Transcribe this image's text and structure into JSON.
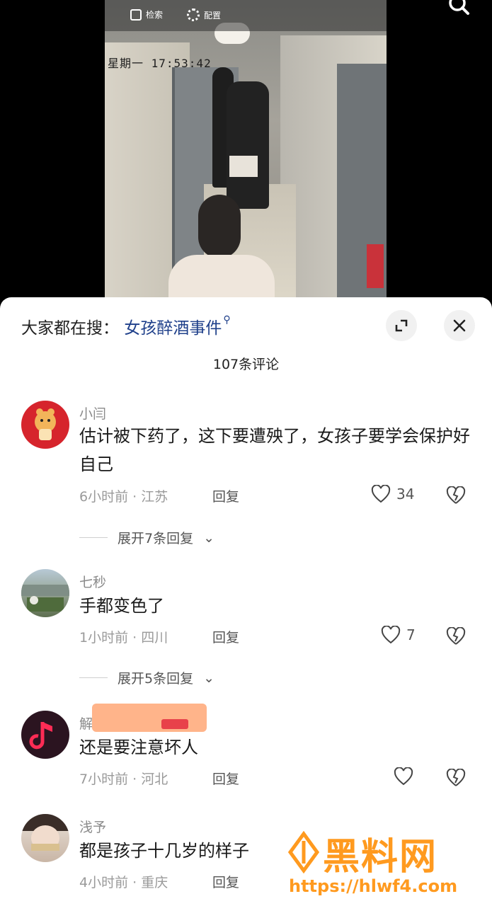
{
  "video": {
    "toolbar": {
      "search_label": "检索",
      "settings_label": "配置"
    },
    "timestamp": "星期一 17:53:42"
  },
  "sheet": {
    "hot_search_prefix": "大家都在搜：",
    "hot_search_term": "女孩醉酒事件",
    "comment_count": "107条评论"
  },
  "comments": [
    {
      "username": "小闫",
      "text": "估计被下药了，这下要遭殃了，女孩子要学会保护好自己",
      "time": "6小时前",
      "location": "江苏",
      "reply_label": "回复",
      "likes": "34",
      "expand_label": "展开7条回复"
    },
    {
      "username": "七秒",
      "text": "手都变色了",
      "time": "1小时前",
      "location": "四川",
      "reply_label": "回复",
      "likes": "7",
      "expand_label": "展开5条回复"
    },
    {
      "username": "解",
      "text": "还是要注意坏人",
      "time": "7小时前",
      "location": "河北",
      "reply_label": "回复",
      "likes": ""
    },
    {
      "username": "浅予",
      "text": "都是孩子十几岁的样子",
      "time": "4小时前",
      "location": "重庆",
      "reply_label": "回复",
      "likes": ""
    }
  ],
  "watermark": {
    "brand": "黑料网",
    "url": "https://hlwf4.com"
  },
  "colors": {
    "accent_link": "#1e3f8a",
    "watermark": "#ff9a1f",
    "music_avatar": "#fe2c55"
  }
}
